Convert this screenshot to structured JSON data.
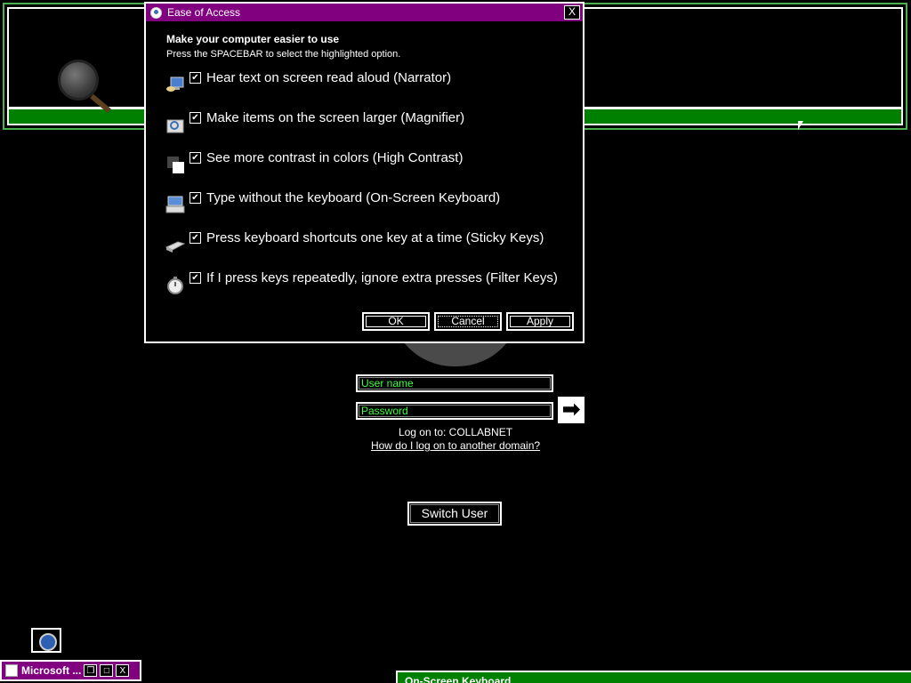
{
  "dialog": {
    "title": "Ease of Access",
    "close_label": "X",
    "heading": "Make your computer easier to use",
    "subheading": "Press the SPACEBAR to select the highlighted option.",
    "options": [
      {
        "label": "Hear text on screen read aloud (Narrator)",
        "checked": true,
        "icon": "narrator-icon"
      },
      {
        "label": "Make items on the screen larger (Magnifier)",
        "checked": true,
        "icon": "magnifier-icon"
      },
      {
        "label": "See more contrast in colors (High Contrast)",
        "checked": true,
        "icon": "high-contrast-icon"
      },
      {
        "label": "Type without the keyboard (On-Screen Keyboard)",
        "checked": true,
        "icon": "keyboard-icon"
      },
      {
        "label": "Press keyboard shortcuts one key at a time (Sticky Keys)",
        "checked": true,
        "icon": "sticky-keys-icon"
      },
      {
        "label": "If I press keys repeatedly, ignore extra presses (Filter Keys)",
        "checked": true,
        "icon": "filter-keys-icon"
      }
    ],
    "buttons": {
      "ok": "OK",
      "cancel": "Cancel",
      "apply": "Apply"
    },
    "check_mark": "✔"
  },
  "logon": {
    "username_placeholder": "User name",
    "password_placeholder": "Password",
    "submit_arrow": "➡",
    "logon_to": "Log on to: COLLABNET",
    "other_domain_link": "How do I log on to another domain?",
    "switch_user": "Switch User"
  },
  "taskbar": {
    "item_label": "Microsoft ...",
    "restore": "❐",
    "maximize": "□",
    "close": "X"
  },
  "osk": {
    "title": "On-Screen Keyboard"
  },
  "colors": {
    "title_bar": "#800080",
    "magnifier_border": "#008000",
    "field_text": "#3cff3c",
    "background": "#000000"
  }
}
